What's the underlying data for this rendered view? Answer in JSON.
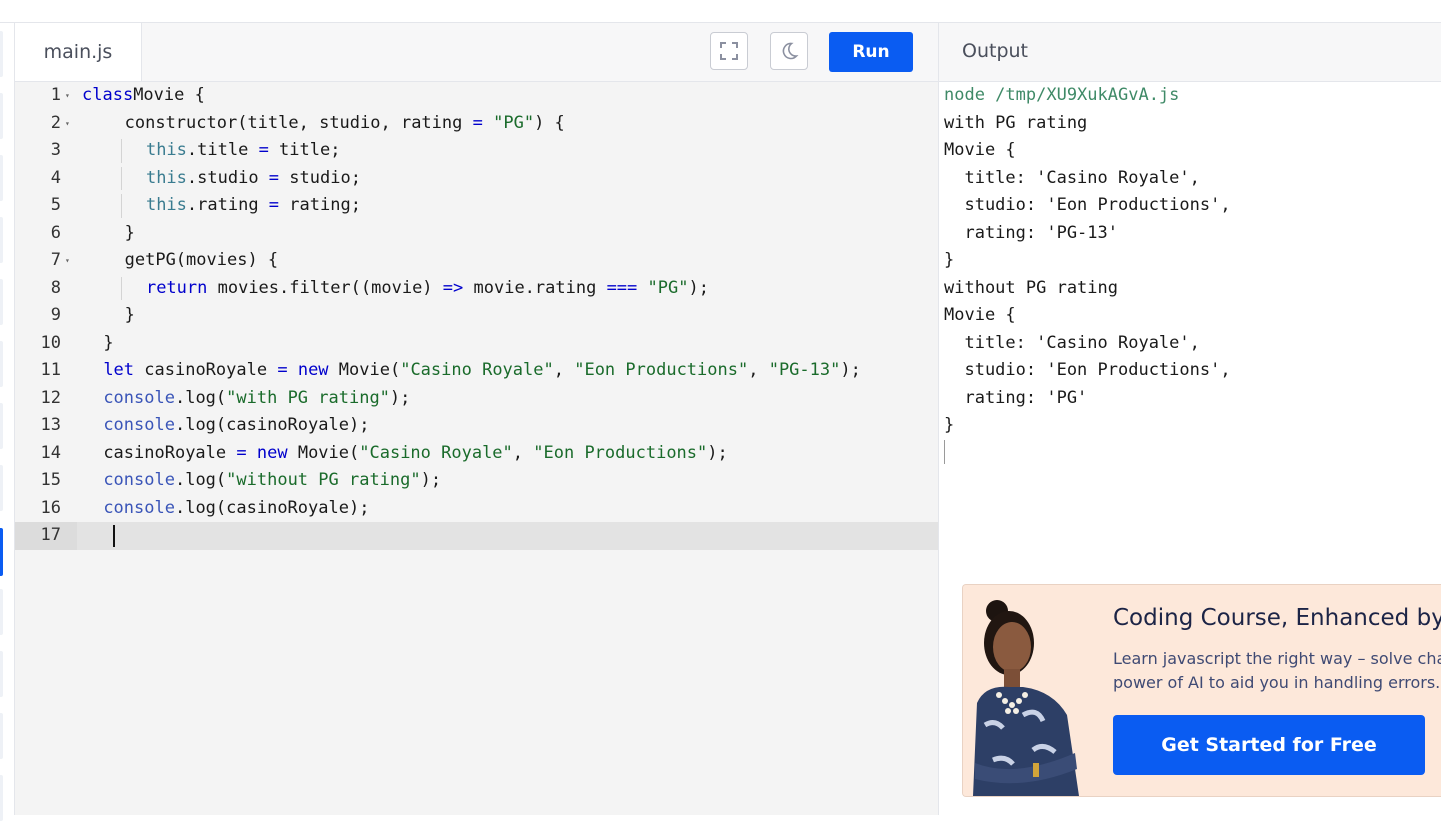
{
  "editor": {
    "file_tab": "main.js",
    "run_label": "Run",
    "lines": [
      {
        "n": "1",
        "fold": true,
        "indent": 0,
        "tokens": [
          [
            "kw",
            "class"
          ],
          [
            "",
            "Movie {"
          ]
        ]
      },
      {
        "n": "2",
        "fold": true,
        "indent": 2,
        "tokens": [
          [
            "",
            "constructor(title, studio, rating "
          ],
          [
            "op",
            "="
          ],
          [
            "",
            " "
          ],
          [
            "str",
            "\"PG\""
          ],
          [
            "",
            ") {"
          ]
        ]
      },
      {
        "n": "3",
        "fold": false,
        "indent": 3,
        "guides": [
          2
        ],
        "tokens": [
          [
            "th",
            "this"
          ],
          [
            "",
            ".title "
          ],
          [
            "op",
            "="
          ],
          [
            "",
            " title;"
          ]
        ]
      },
      {
        "n": "4",
        "fold": false,
        "indent": 3,
        "guides": [
          2
        ],
        "tokens": [
          [
            "th",
            "this"
          ],
          [
            "",
            ".studio "
          ],
          [
            "op",
            "="
          ],
          [
            "",
            " studio;"
          ]
        ]
      },
      {
        "n": "5",
        "fold": false,
        "indent": 3,
        "guides": [
          2
        ],
        "tokens": [
          [
            "th",
            "this"
          ],
          [
            "",
            ".rating "
          ],
          [
            "op",
            "="
          ],
          [
            "",
            " rating;"
          ]
        ]
      },
      {
        "n": "6",
        "fold": false,
        "indent": 2,
        "tokens": [
          [
            "",
            "}"
          ]
        ]
      },
      {
        "n": "7",
        "fold": true,
        "indent": 2,
        "tokens": [
          [
            "",
            "getPG(movies) {"
          ]
        ]
      },
      {
        "n": "8",
        "fold": false,
        "indent": 3,
        "guides": [
          2
        ],
        "tokens": [
          [
            "kw",
            "return"
          ],
          [
            "",
            " movies.filter((movie) "
          ],
          [
            "op",
            "=>"
          ],
          [
            "",
            " movie.rating "
          ],
          [
            "op",
            "==="
          ],
          [
            "",
            " "
          ],
          [
            "str",
            "\"PG\""
          ],
          [
            "",
            ");"
          ]
        ]
      },
      {
        "n": "9",
        "fold": false,
        "indent": 2,
        "tokens": [
          [
            "",
            "}"
          ]
        ]
      },
      {
        "n": "10",
        "fold": false,
        "indent": 1,
        "tokens": [
          [
            "",
            "}"
          ]
        ]
      },
      {
        "n": "11",
        "fold": false,
        "indent": 1,
        "tokens": [
          [
            "kw",
            "let"
          ],
          [
            "",
            " casinoRoyale "
          ],
          [
            "op",
            "="
          ],
          [
            "",
            " "
          ],
          [
            "kw",
            "new"
          ],
          [
            "",
            " Movie("
          ],
          [
            "str",
            "\"Casino Royale\""
          ],
          [
            "",
            ", "
          ],
          [
            "str",
            "\"Eon Productions\""
          ],
          [
            "",
            ", "
          ],
          [
            "str",
            "\"PG-13\""
          ],
          [
            "",
            ");"
          ]
        ]
      },
      {
        "n": "12",
        "fold": false,
        "indent": 1,
        "tokens": [
          [
            "fn",
            "console"
          ],
          [
            "",
            ".log("
          ],
          [
            "str",
            "\"with PG rating\""
          ],
          [
            "",
            ");"
          ]
        ]
      },
      {
        "n": "13",
        "fold": false,
        "indent": 1,
        "tokens": [
          [
            "fn",
            "console"
          ],
          [
            "",
            ".log(casinoRoyale);"
          ]
        ]
      },
      {
        "n": "14",
        "fold": false,
        "indent": 1,
        "tokens": [
          [
            "",
            "casinoRoyale "
          ],
          [
            "op",
            "="
          ],
          [
            "",
            " "
          ],
          [
            "kw",
            "new"
          ],
          [
            "",
            " Movie("
          ],
          [
            "str",
            "\"Casino Royale\""
          ],
          [
            "",
            ", "
          ],
          [
            "str",
            "\"Eon Productions\""
          ],
          [
            "",
            ");"
          ]
        ]
      },
      {
        "n": "15",
        "fold": false,
        "indent": 1,
        "tokens": [
          [
            "fn",
            "console"
          ],
          [
            "",
            ".log("
          ],
          [
            "str",
            "\"without PG rating\""
          ],
          [
            "",
            ");"
          ]
        ]
      },
      {
        "n": "16",
        "fold": false,
        "indent": 1,
        "tokens": [
          [
            "fn",
            "console"
          ],
          [
            "",
            ".log(casinoRoyale);"
          ]
        ]
      },
      {
        "n": "17",
        "fold": false,
        "indent": 0,
        "active": true,
        "tokens": []
      }
    ]
  },
  "output": {
    "title": "Output",
    "command": "node /tmp/XU9XukAGvA.js",
    "lines": [
      "with PG rating",
      "Movie {",
      "  title: 'Casino Royale',",
      "  studio: 'Eon Productions',",
      "  rating: 'PG-13'",
      "}",
      "without PG rating",
      "Movie {",
      "  title: 'Casino Royale',",
      "  studio: 'Eon Productions',",
      "  rating: 'PG'",
      "}"
    ]
  },
  "ad": {
    "title": "Coding Course, Enhanced by AI",
    "text_line1": "Learn javascript the right way – solve challenges with the",
    "text_line2": "power of AI to aid you in handling errors.",
    "button": "Get Started for Free",
    "bg_color": "#fde8da"
  },
  "colors": {
    "accent": "#0a5cf2",
    "keyword": "#0000cc",
    "string": "#1a6b2b",
    "output_command": "#3f8a67"
  },
  "icons": {
    "fullscreen": "fullscreen-icon",
    "theme": "moon-icon"
  }
}
